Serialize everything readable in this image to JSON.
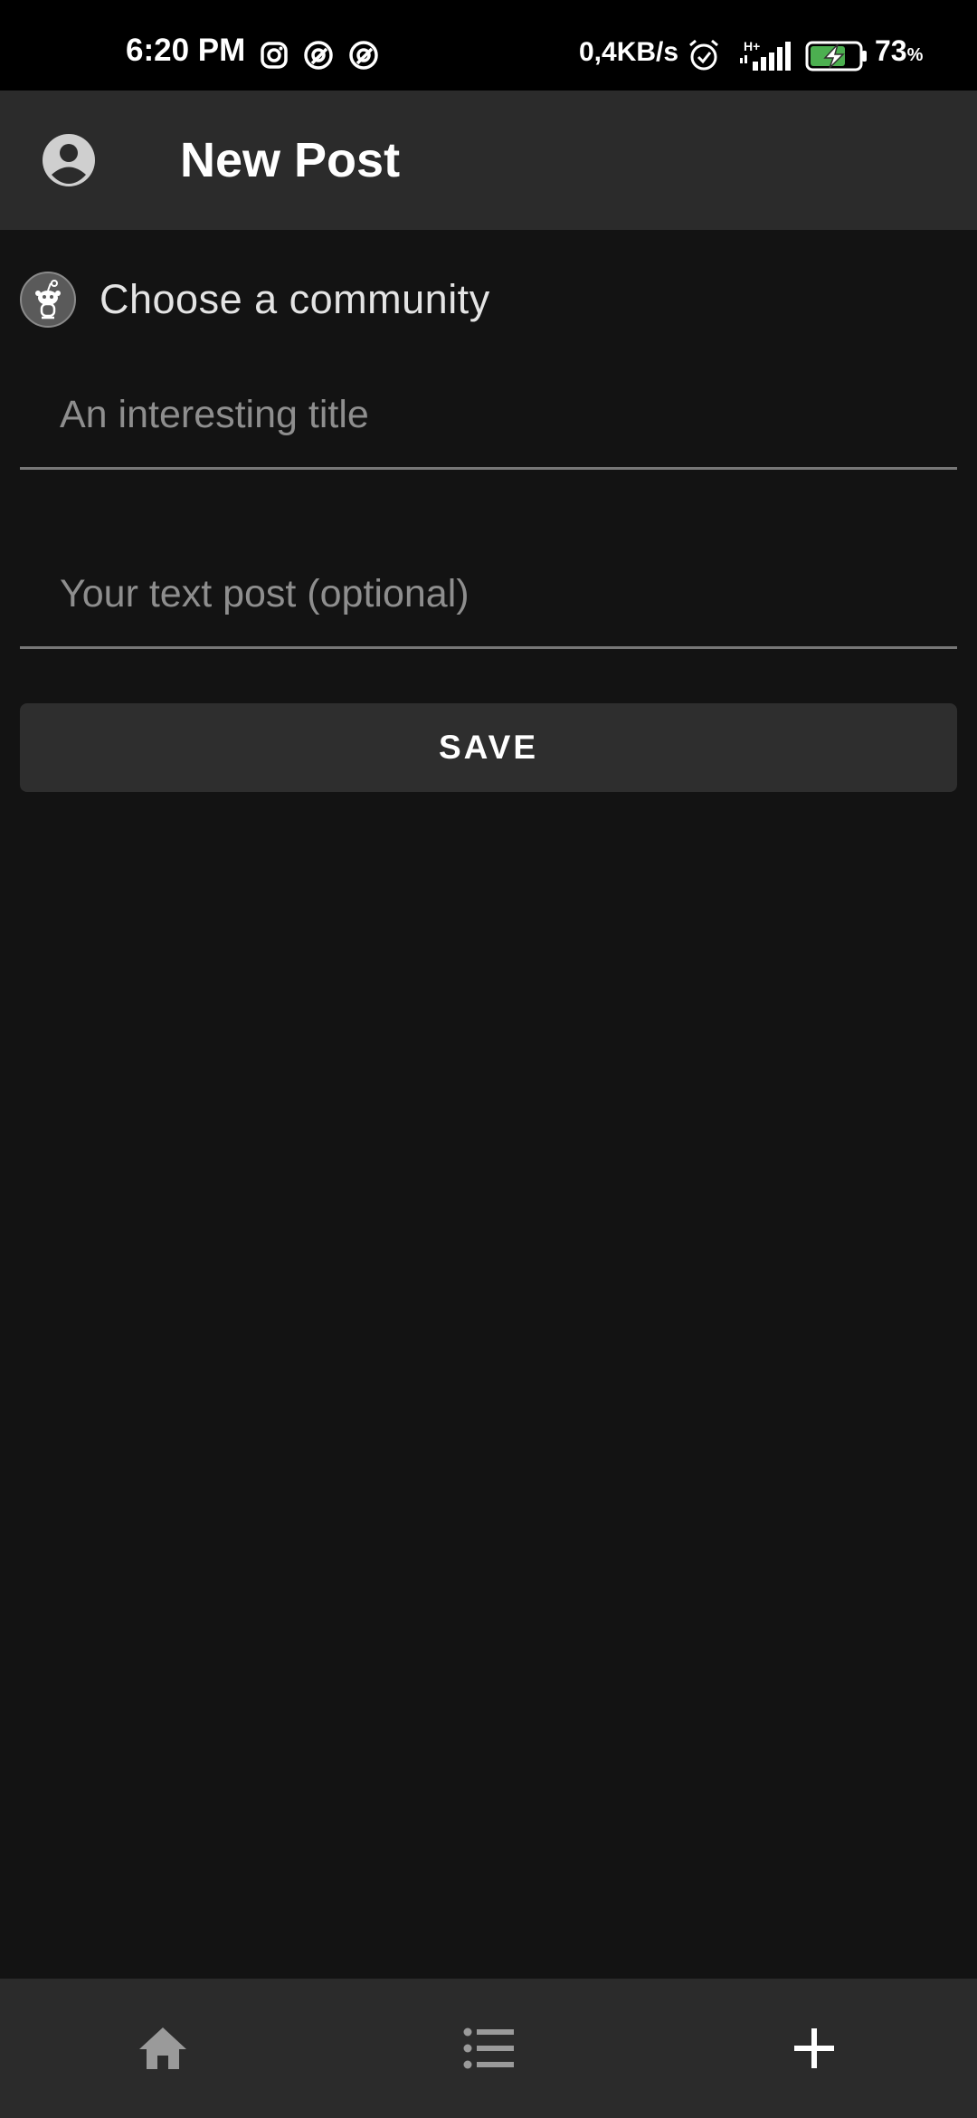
{
  "status_bar": {
    "time": "6:20 PM",
    "net_speed": "0,4KB/s",
    "network_type": "H+",
    "battery_percent": "73",
    "battery_unit": "%",
    "battery_level": 0.73,
    "icons": [
      "instagram-icon",
      "app-notification-icon",
      "app-notification-icon",
      "alarm-icon",
      "signal-icon",
      "battery-charging-icon"
    ]
  },
  "header": {
    "title": "New Post",
    "account_icon": "account-circle-icon"
  },
  "form": {
    "community_label": "Choose a community",
    "community_icon": "reddit-alien-icon",
    "title_placeholder": "An interesting title",
    "title_value": "",
    "body_placeholder": "Your text post (optional)",
    "body_value": "",
    "save_label": "SAVE"
  },
  "bottom_nav": {
    "items": [
      {
        "icon": "home-icon"
      },
      {
        "icon": "list-icon"
      },
      {
        "icon": "plus-icon"
      }
    ]
  },
  "colors": {
    "background": "#131313",
    "app_bar": "#2b2b2b",
    "button": "#2e2e2e",
    "battery_fill": "#4caf50"
  }
}
